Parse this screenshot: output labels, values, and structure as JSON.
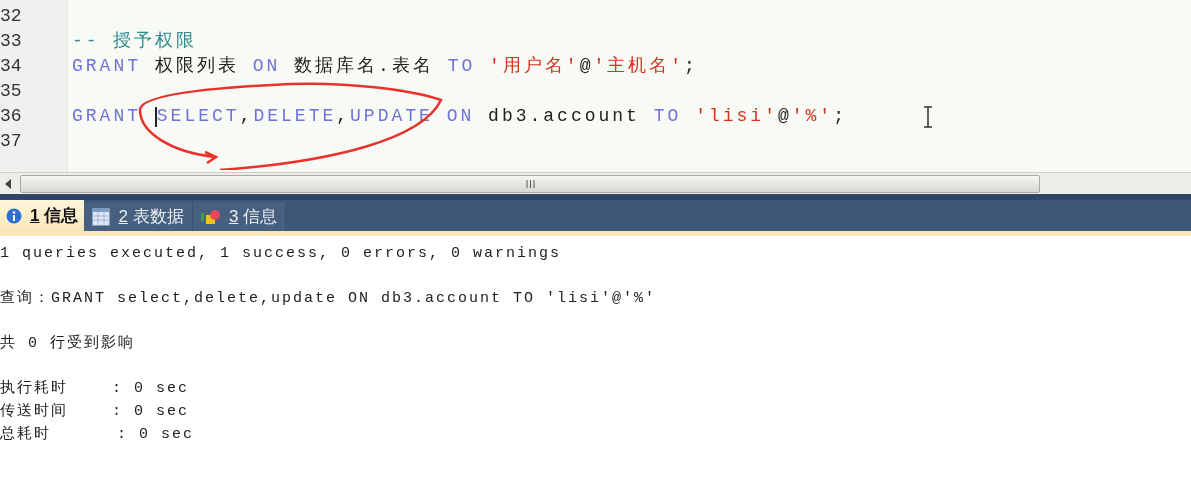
{
  "editor": {
    "lines": [
      {
        "number": "32"
      },
      {
        "number": "33",
        "tokens": [
          {
            "kind": "comment",
            "text": "-- 授予权限"
          }
        ]
      },
      {
        "number": "34",
        "tokens": [
          {
            "kind": "keyword",
            "text": "GRANT"
          },
          {
            "kind": "plain",
            "text": " 权限列表 "
          },
          {
            "kind": "keyword",
            "text": "ON"
          },
          {
            "kind": "plain",
            "text": " 数据库名.表名 "
          },
          {
            "kind": "keyword",
            "text": "TO "
          },
          {
            "kind": "string",
            "text": "'用户名'"
          },
          {
            "kind": "plain",
            "text": "@"
          },
          {
            "kind": "string",
            "text": "'主机名'"
          },
          {
            "kind": "plain",
            "text": ";"
          }
        ]
      },
      {
        "number": "35"
      },
      {
        "number": "36",
        "caret": true,
        "tokens": [
          {
            "kind": "keyword",
            "text": "GRANT "
          },
          {
            "kind": "keyword",
            "text": "SELECT"
          },
          {
            "kind": "plain",
            "text": ","
          },
          {
            "kind": "keyword",
            "text": "DELETE"
          },
          {
            "kind": "plain",
            "text": ","
          },
          {
            "kind": "keyword",
            "text": "UPDATE ON"
          },
          {
            "kind": "plain",
            "text": " db3.account "
          },
          {
            "kind": "keyword",
            "text": "TO "
          },
          {
            "kind": "string",
            "text": "'lisi'"
          },
          {
            "kind": "plain",
            "text": "@"
          },
          {
            "kind": "string",
            "text": "'%'"
          },
          {
            "kind": "plain",
            "text": ";"
          }
        ]
      },
      {
        "number": "37"
      }
    ]
  },
  "result_tabs": [
    {
      "number": "1",
      "label": "信息",
      "selected": true
    },
    {
      "number": "2",
      "label": "表数据",
      "selected": false
    },
    {
      "number": "3",
      "label": "信息",
      "selected": false
    }
  ],
  "output": {
    "paragraphs": [
      [
        "1 queries executed, 1 success, 0 errors, 0 warnings"
      ],
      [
        "查询：GRANT select,delete,update ON db3.account TO 'lisi'@'%'"
      ],
      [
        "共 0 行受到影响"
      ],
      [
        "执行耗时    : 0 sec",
        "传送时间    : 0 sec",
        "总耗时      : 0 sec"
      ]
    ]
  }
}
